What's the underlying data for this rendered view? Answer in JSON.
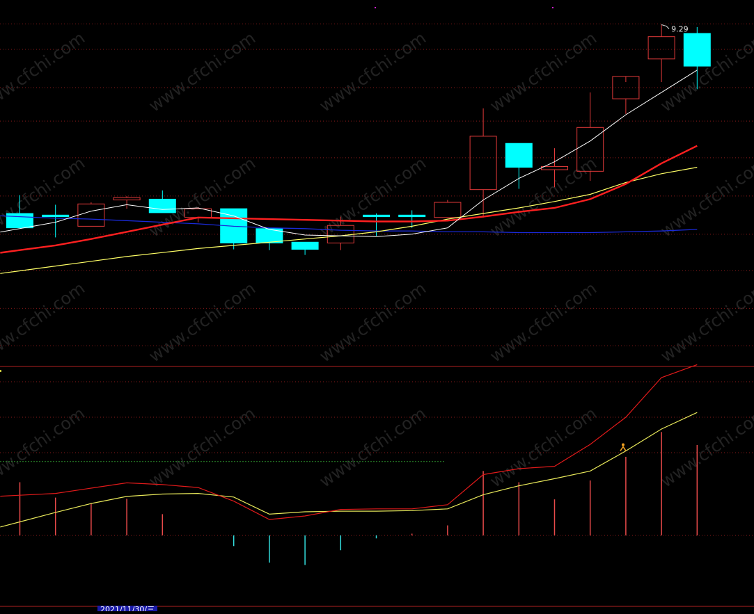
{
  "chart_data": [
    {
      "type": "candlestick",
      "max_label": "9.29",
      "ylim": [
        5.0,
        9.6
      ],
      "gridlines": [
        9.3,
        8.98,
        8.5,
        8.08,
        7.62,
        7.14,
        6.66,
        6.2,
        5.73,
        5.26
      ],
      "colors": {
        "up": "#e23a3a",
        "down": "#00ffff",
        "ma5": "#ffffff",
        "ma10": "#ff2020",
        "ma20": "#ffff66",
        "ma60": "#1a2ad8",
        "grid": "#8a1a1a"
      },
      "candles": [
        {
          "open": 6.92,
          "high": 7.15,
          "low": 6.75,
          "close": 6.74
        },
        {
          "open": 6.9,
          "high": 7.03,
          "low": 6.62,
          "close": 6.88
        },
        {
          "open": 6.76,
          "high": 7.06,
          "low": 6.76,
          "close": 7.04
        },
        {
          "open": 7.09,
          "high": 7.14,
          "low": 6.98,
          "close": 7.12
        },
        {
          "open": 7.1,
          "high": 7.21,
          "low": 6.96,
          "close": 6.93
        },
        {
          "open": 6.87,
          "high": 7.0,
          "low": 6.81,
          "close": 6.98
        },
        {
          "open": 6.98,
          "high": 6.98,
          "low": 6.47,
          "close": 6.55
        },
        {
          "open": 6.73,
          "high": 6.73,
          "low": 6.46,
          "close": 6.55
        },
        {
          "open": 6.56,
          "high": 6.56,
          "low": 6.4,
          "close": 6.47
        },
        {
          "open": 6.55,
          "high": 6.88,
          "low": 6.46,
          "close": 6.77
        },
        {
          "open": 6.9,
          "high": 6.92,
          "low": 6.64,
          "close": 6.88
        },
        {
          "open": 6.9,
          "high": 6.96,
          "low": 6.74,
          "close": 6.88
        },
        {
          "open": 6.87,
          "high": 7.09,
          "low": 6.87,
          "close": 7.06
        },
        {
          "open": 7.22,
          "high": 8.24,
          "low": 6.87,
          "close": 7.89
        },
        {
          "open": 7.8,
          "high": 7.8,
          "low": 7.23,
          "close": 7.5
        },
        {
          "open": 7.47,
          "high": 7.74,
          "low": 7.25,
          "close": 7.51
        },
        {
          "open": 7.45,
          "high": 8.44,
          "low": 7.33,
          "close": 8.0
        },
        {
          "open": 8.36,
          "high": 8.57,
          "low": 8.17,
          "close": 8.64
        },
        {
          "open": 8.86,
          "high": 9.29,
          "low": 8.57,
          "close": 9.14
        },
        {
          "open": 9.18,
          "high": 9.26,
          "low": 8.48,
          "close": 8.77
        }
      ],
      "ma5": [
        6.73,
        6.81,
        6.95,
        7.03,
        6.97,
        6.99,
        6.89,
        6.72,
        6.65,
        6.64,
        6.63,
        6.66,
        6.74,
        7.09,
        7.36,
        7.57,
        7.83,
        8.16,
        8.44,
        8.72
      ],
      "ma10": [
        6.46,
        6.52,
        6.6,
        6.69,
        6.78,
        6.87,
        6.86,
        6.85,
        6.84,
        6.83,
        6.82,
        6.82,
        6.83,
        6.88,
        6.94,
        6.99,
        7.1,
        7.29,
        7.55,
        7.77
      ],
      "ma20": [
        6.2,
        6.26,
        6.32,
        6.38,
        6.43,
        6.48,
        6.52,
        6.56,
        6.6,
        6.64,
        6.69,
        6.76,
        6.85,
        6.92,
        6.99,
        7.07,
        7.16,
        7.31,
        7.42,
        7.5
      ],
      "ma60": [
        6.88,
        6.86,
        6.85,
        6.83,
        6.81,
        6.79,
        6.76,
        6.74,
        6.73,
        6.71,
        6.7,
        6.7,
        6.69,
        6.69,
        6.68,
        6.68,
        6.68,
        6.69,
        6.7,
        6.72
      ]
    },
    {
      "type": "macd",
      "ylim": [
        -0.12,
        0.28
      ],
      "zero": 0,
      "reference_level": 0.125,
      "gridlines": [
        0.26,
        0.2,
        0.14,
        0.0,
        -0.15
      ],
      "colors": {
        "dif": "#e01a1a",
        "dea": "#e8e85a",
        "bar_up": "#e84a4a",
        "bar_down": "#33dddd",
        "reference": "#2a8a2a",
        "grid": "#8a1a1a"
      },
      "dif": [
        0.068,
        0.071,
        0.08,
        0.089,
        0.086,
        0.081,
        0.058,
        0.027,
        0.033,
        0.044,
        0.045,
        0.045,
        0.052,
        0.103,
        0.113,
        0.117,
        0.154,
        0.2,
        0.267,
        0.289
      ],
      "dea": [
        0.023,
        0.039,
        0.054,
        0.066,
        0.07,
        0.071,
        0.065,
        0.036,
        0.04,
        0.041,
        0.041,
        0.042,
        0.045,
        0.069,
        0.084,
        0.096,
        0.109,
        0.143,
        0.18,
        0.208
      ],
      "bars": [
        0.09,
        0.064,
        0.054,
        0.062,
        0.036,
        0.0,
        -0.018,
        -0.046,
        -0.05,
        -0.025,
        -0.005,
        0.003,
        0.017,
        0.109,
        0.09,
        0.061,
        0.093,
        0.133,
        0.175,
        0.153
      ]
    }
  ],
  "date_label": "2021/11/30/三"
}
